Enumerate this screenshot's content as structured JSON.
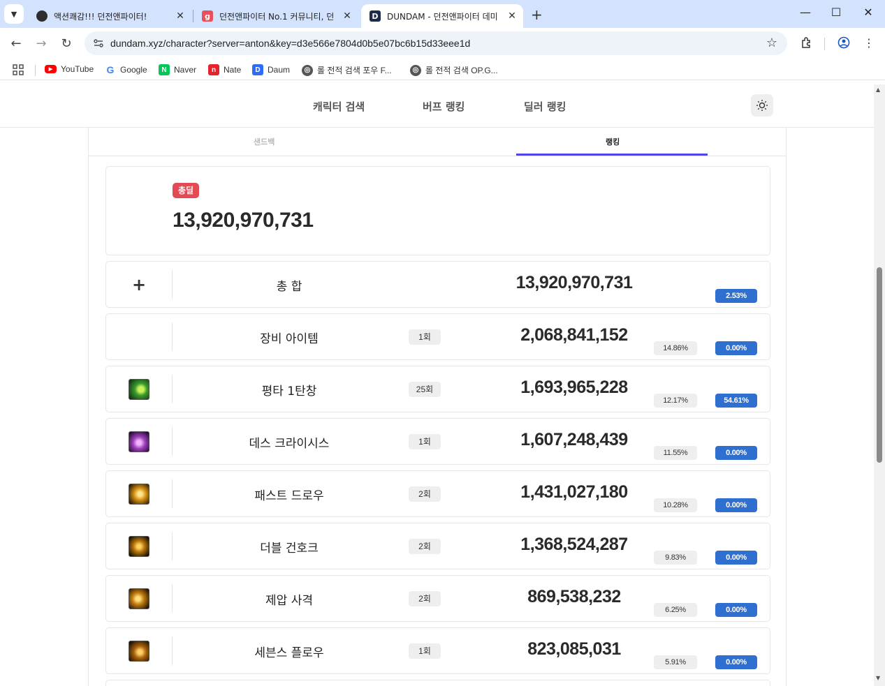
{
  "browser": {
    "tabs": [
      {
        "title": "액션쾌감!!! 던전앤파이터!",
        "favicon_color": "#2d2d2d"
      },
      {
        "title": "던전앤파이터 No.1 커뮤니티, 던",
        "favicon_text": "g",
        "favicon_color": "#e8505b"
      },
      {
        "title": "DUNDAM - 던전앤파이터 데미",
        "favicon_text": "D",
        "favicon_color": "#1c2b4a"
      }
    ],
    "url": "dundam.xyz/character?server=anton&key=d3e566e7804d0b5e07bc6b15d33eee1d",
    "bookmarks": [
      {
        "label": "YouTube",
        "color": "#ff0000",
        "icon": "youtube-icon"
      },
      {
        "label": "Google",
        "color": "#4285f4",
        "icon": "google-icon"
      },
      {
        "label": "Naver",
        "color": "#03c75a",
        "icon": "naver-icon"
      },
      {
        "label": "Nate",
        "color": "#e8222c",
        "icon": "nate-icon"
      },
      {
        "label": "Daum",
        "color": "#2d6cf6",
        "icon": "daum-icon"
      },
      {
        "label": "롤 전적 검색 포우 F...",
        "color": "#555555",
        "icon": "globe-icon"
      },
      {
        "label": "롤 전적 검색 OP.G...",
        "color": "#555555",
        "icon": "globe-icon"
      }
    ]
  },
  "site": {
    "nav": [
      "캐릭터 검색",
      "버프 랭킹",
      "딜러 랭킹"
    ],
    "subtabs": {
      "left": "샌드백",
      "right": "랭킹"
    },
    "accent": "#4f46e5"
  },
  "summary": {
    "badge": "총딜",
    "value": "13,920,970,731",
    "badge_color": "#e24a54"
  },
  "rows": [
    {
      "icon": "plus-icon",
      "name": "총 합",
      "count": "",
      "damage": "13,920,970,731",
      "share": "",
      "change": "2.53%"
    },
    {
      "icon": "none",
      "name": "장비 아이템",
      "count": "1회",
      "damage": "2,068,841,152",
      "share": "14.86%",
      "change": "0.00%"
    },
    {
      "icon": "skill-icon-green",
      "name": "평타 1탄창",
      "count": "25회",
      "damage": "1,693,965,228",
      "share": "12.17%",
      "change": "54.61%"
    },
    {
      "icon": "skill-icon-purple",
      "name": "데스 크라이시스",
      "count": "1회",
      "damage": "1,607,248,439",
      "share": "11.55%",
      "change": "0.00%"
    },
    {
      "icon": "skill-icon-gold",
      "name": "패스트 드로우",
      "count": "2회",
      "damage": "1,431,027,180",
      "share": "10.28%",
      "change": "0.00%"
    },
    {
      "icon": "skill-icon-gold",
      "name": "더블 건호크",
      "count": "2회",
      "damage": "1,368,524,287",
      "share": "9.83%",
      "change": "0.00%"
    },
    {
      "icon": "skill-icon-gold",
      "name": "제압 사격",
      "count": "2회",
      "damage": "869,538,232",
      "share": "6.25%",
      "change": "0.00%"
    },
    {
      "icon": "skill-icon-gold",
      "name": "세븐스 플로우",
      "count": "1회",
      "damage": "823,085,031",
      "share": "5.91%",
      "change": "0.00%"
    }
  ]
}
